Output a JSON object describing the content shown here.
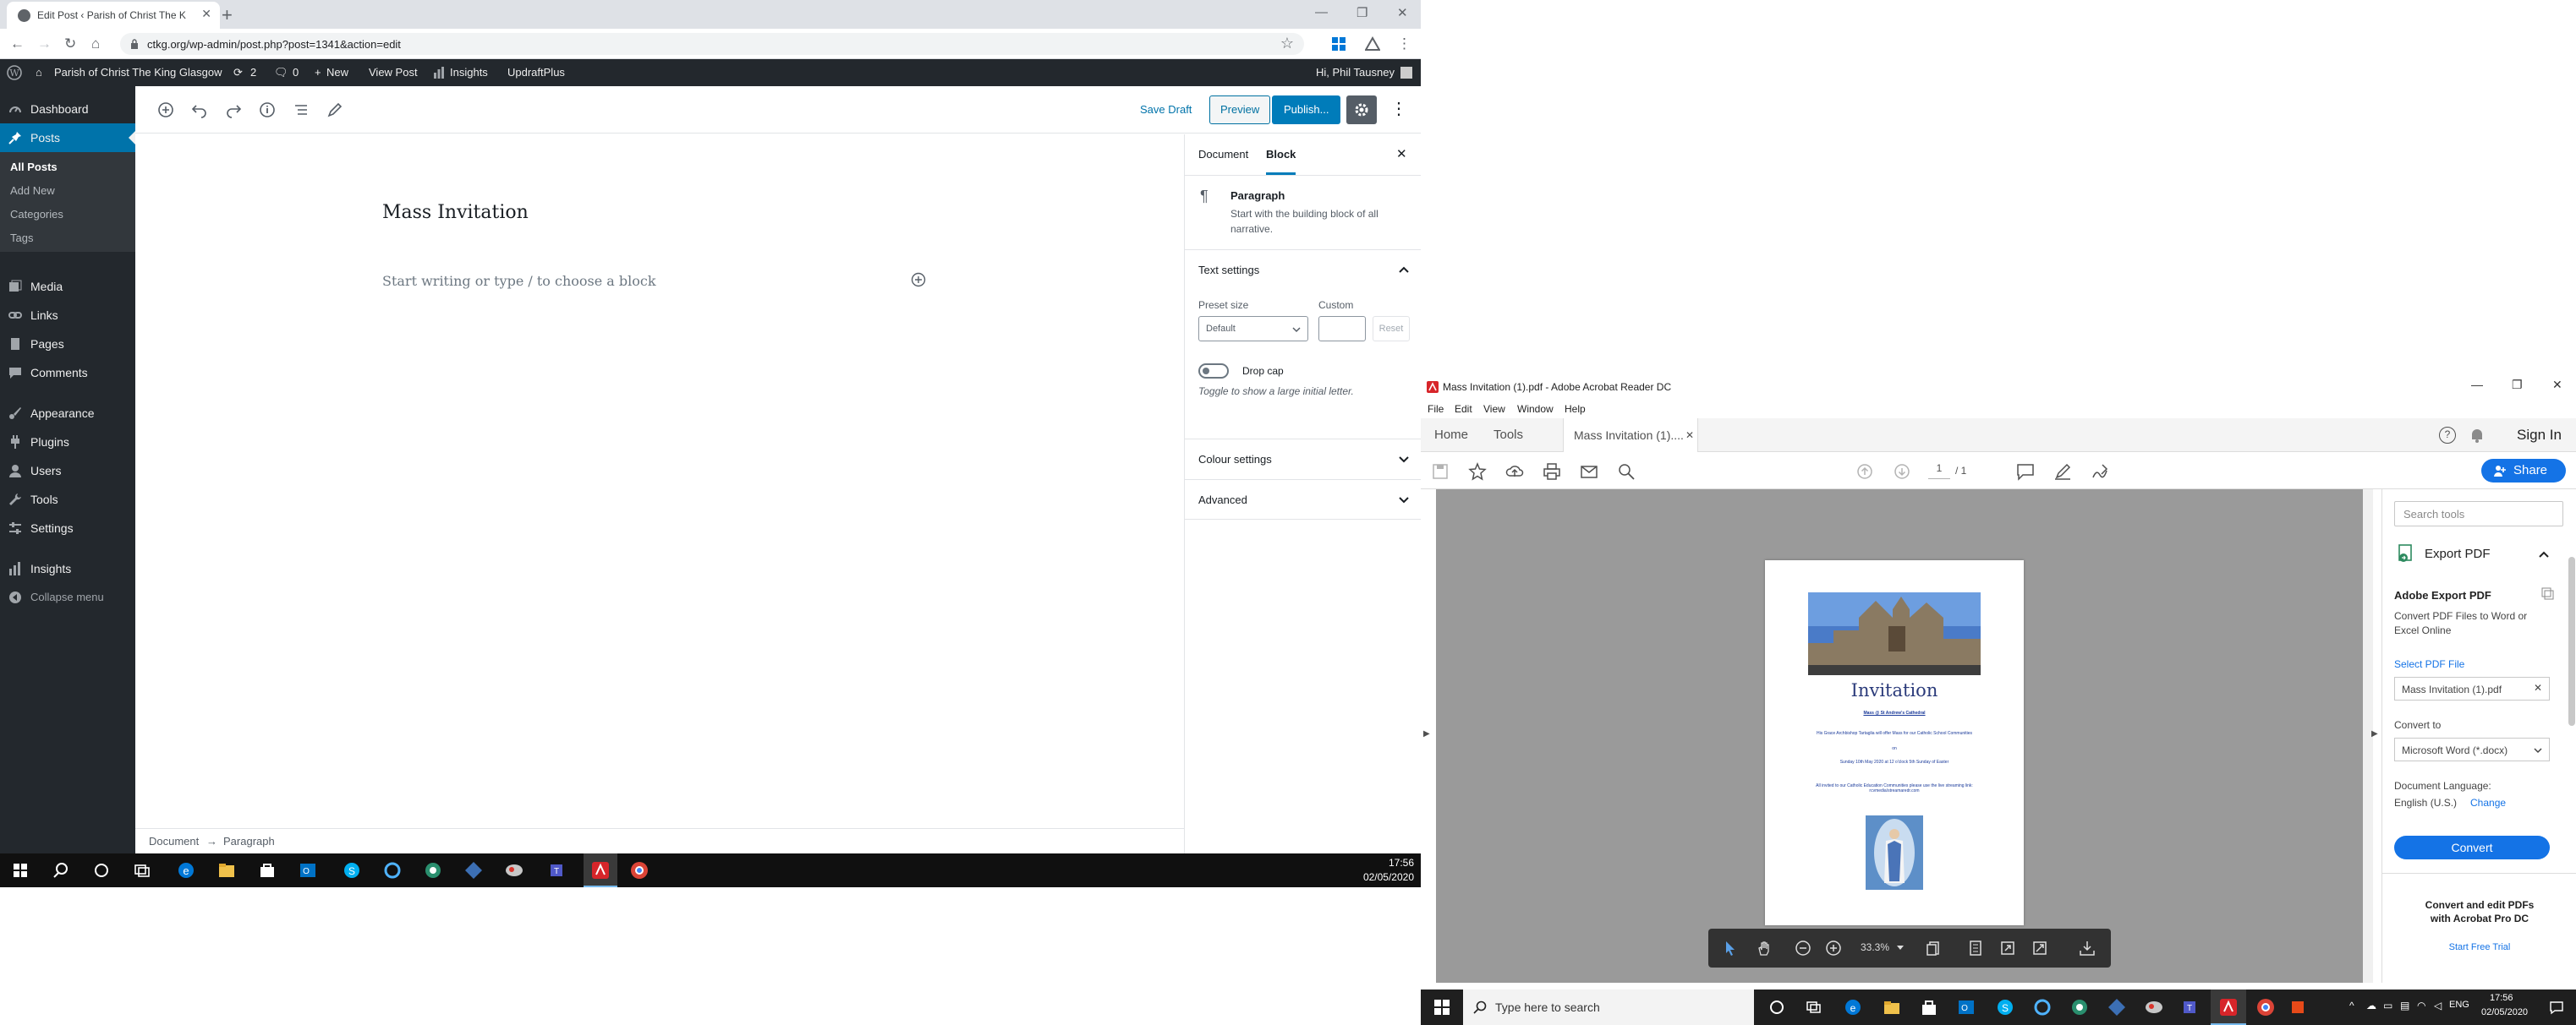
{
  "chrome": {
    "tab_title": "Edit Post ‹ Parish of Christ The K",
    "new_tab": "+",
    "url": "ctkg.org/wp-admin/post.php?post=1341&action=edit"
  },
  "wp_admin_bar": {
    "site_name": "Parish of Christ The King Glasgow",
    "updates": "2",
    "comments": "0",
    "new_label": "New",
    "view_post": "View Post",
    "insights": "Insights",
    "updraft": "UpdraftPlus",
    "greeting": "Hi, Phil Tausney"
  },
  "sidebar": {
    "dashboard": "Dashboard",
    "posts": "Posts",
    "sub": [
      "All Posts",
      "Add New",
      "Categories",
      "Tags"
    ],
    "media": "Media",
    "links": "Links",
    "pages": "Pages",
    "comments": "Comments",
    "appearance": "Appearance",
    "plugins": "Plugins",
    "users": "Users",
    "tools": "Tools",
    "settings": "Settings",
    "insights": "Insights",
    "collapse": "Collapse menu"
  },
  "editor": {
    "save_draft": "Save Draft",
    "preview": "Preview",
    "publish": "Publish...",
    "title": "Mass Invitation",
    "placeholder": "Start writing or type / to choose a block",
    "breadcrumb_doc": "Document",
    "breadcrumb_arrow": "→",
    "breadcrumb_block": "Paragraph"
  },
  "settings_panel": {
    "tab_document": "Document",
    "tab_block": "Block",
    "block_name": "Paragraph",
    "block_desc": "Start with the building block of all narrative.",
    "text_settings": "Text settings",
    "preset_size": "Preset size",
    "preset_value": "Default",
    "custom": "Custom",
    "reset": "Reset",
    "drop_cap": "Drop cap",
    "drop_cap_help": "Toggle to show a large initial letter.",
    "colour_settings": "Colour settings",
    "advanced": "Advanced"
  },
  "taskbar1": {
    "time": "17:56",
    "date": "02/05/2020"
  },
  "acrobat": {
    "title": "Mass Invitation (1).pdf - Adobe Acrobat Reader DC",
    "menu": [
      "File",
      "Edit",
      "View",
      "Window",
      "Help"
    ],
    "tab_home": "Home",
    "tab_tools": "Tools",
    "tab_doc": "Mass Invitation (1)....",
    "sign_in": "Sign In",
    "share": "Share",
    "page_current": "1",
    "page_total": "/ 1",
    "zoom": "33.3%",
    "search_tools": "Search tools",
    "export_pdf": "Export PDF",
    "adobe_export_title": "Adobe Export PDF",
    "adobe_export_desc": "Convert PDF Files to Word or Excel Online",
    "select_pdf": "Select PDF File",
    "file_name": "Mass Invitation (1).pdf",
    "convert_to": "Convert to",
    "format": "Microsoft Word (*.docx)",
    "doc_language": "Document Language:",
    "language": "English (U.S.)",
    "change": "Change",
    "convert": "Convert",
    "promo": "Convert and edit PDFs with Acrobat Pro DC",
    "free_trial": "Start Free Trial"
  },
  "pdf_page": {
    "heading": "Invitation",
    "line1": "Mass @ St Andrew's Cathedral",
    "line2": "His Grace Archbishop Tartaglia will offer Mass for our Catholic School Communities",
    "line3": "on",
    "line4": "Sunday 10th May 2020 at 12 o'clock 5th Sunday of Easter",
    "line5": "All invited to our Catholic Education Communities please use the live streaming link: rcvmedia/streamaredr.com"
  },
  "taskbar2": {
    "search": "Type here to search",
    "lang": "ENG",
    "time": "17:56",
    "date": "02/05/2020"
  },
  "colors": {
    "wp_dark": "#23282d",
    "wp_blue": "#0073aa",
    "publish_blue": "#007cba",
    "acrobat_blue": "#1473e6",
    "acrobat_red": "#d7252a"
  }
}
